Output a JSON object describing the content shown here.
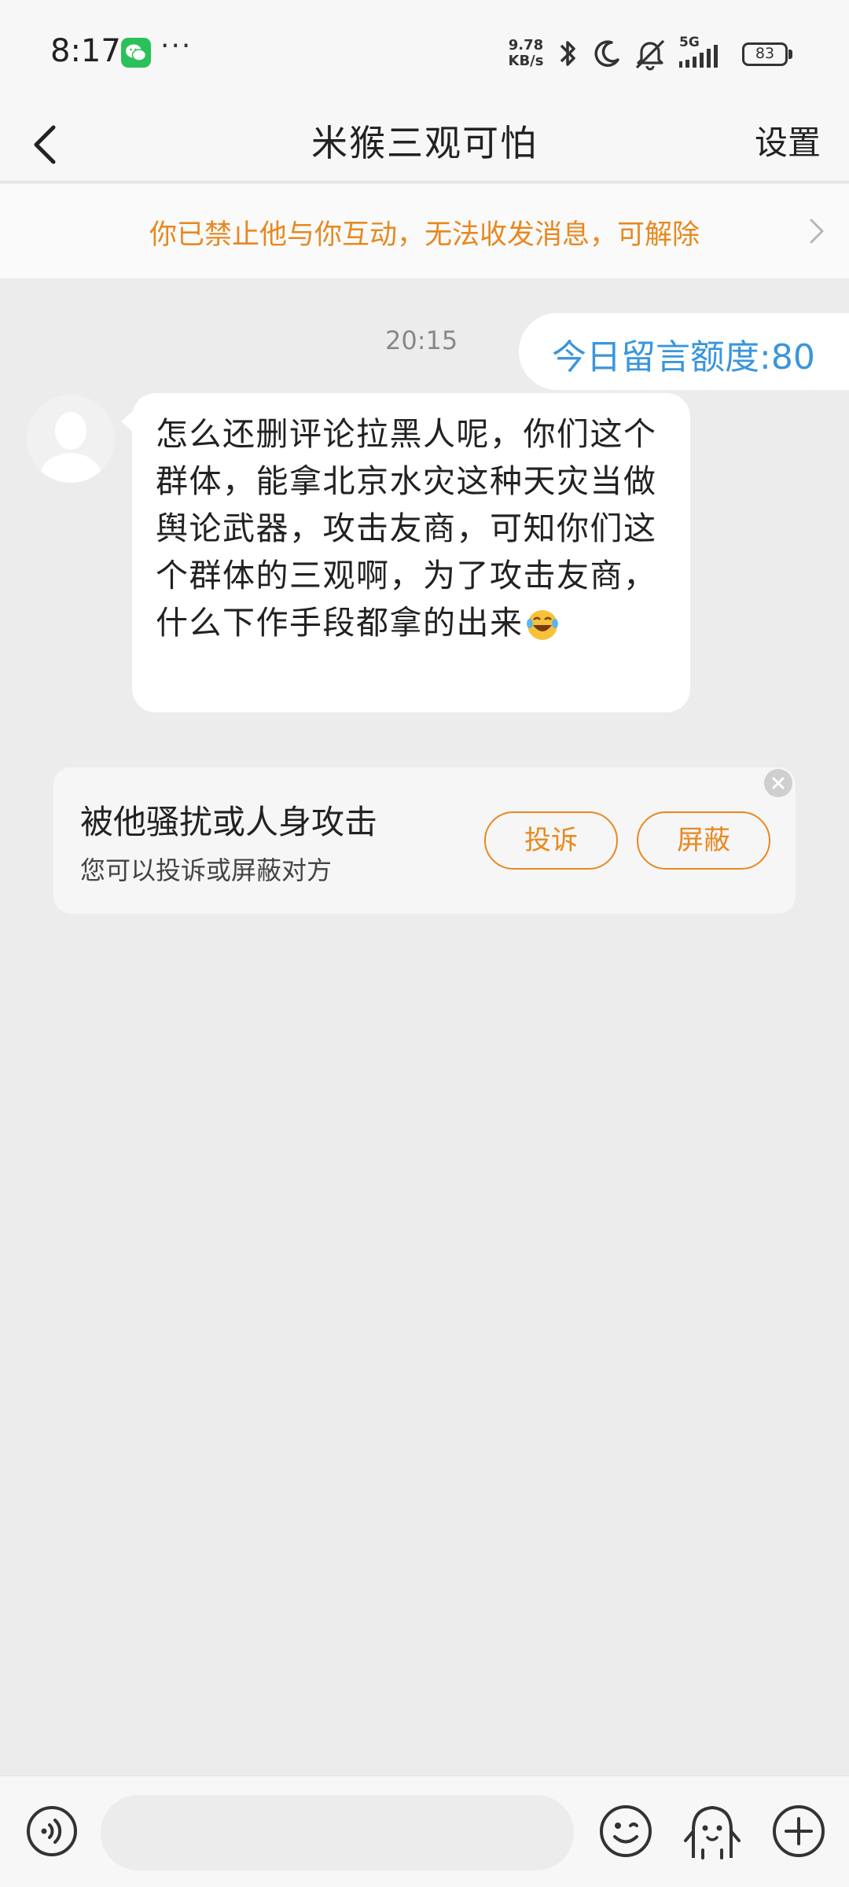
{
  "status_bar": {
    "time": "8:17",
    "more": "···",
    "net_speed_value": "9.78",
    "net_speed_unit": "KB/s",
    "network": "5G",
    "battery": "83"
  },
  "header": {
    "title": "米猴三观可怕",
    "settings_label": "设置"
  },
  "banner": {
    "text": "你已禁止他与你互动，无法收发消息，可解除"
  },
  "chat": {
    "timestamp": "20:15",
    "quota_label": "今日留言额度:80",
    "message_text": "怎么还删评论拉黑人呢，你们这个群体，能拿北京水灾这种天灾当做舆论武器，攻击友商，可知你们这个群体的三观啊，为了攻击友商，什么下作手段都拿的出来",
    "message_emoji": "laughing-tears-icon"
  },
  "report_card": {
    "title": "被他骚扰或人身攻击",
    "subtitle": "您可以投诉或屏蔽对方",
    "complain_label": "投诉",
    "block_label": "屏蔽"
  },
  "input_bar": {
    "placeholder": ""
  },
  "colors": {
    "accent_orange": "#e8881f",
    "quota_blue": "#3a96dd",
    "background": "#ececec"
  }
}
